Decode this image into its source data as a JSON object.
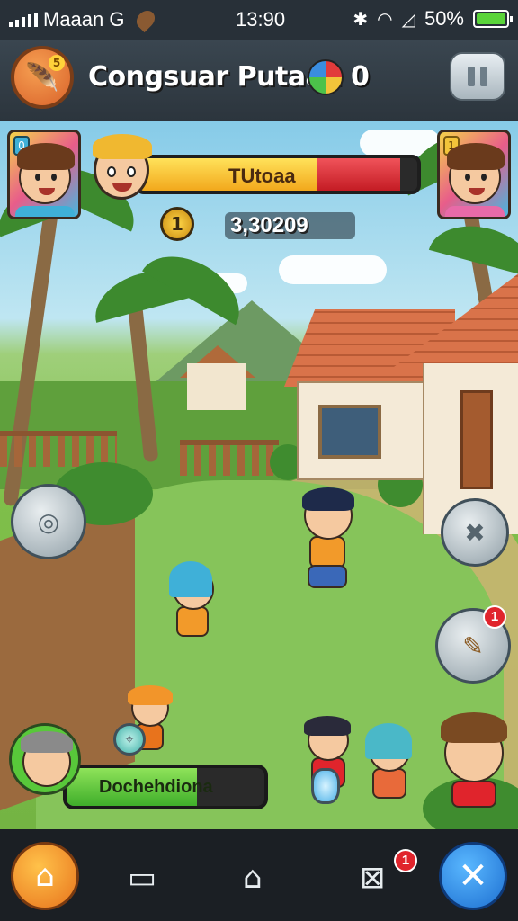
{
  "status_bar": {
    "carrier": "Maaan G",
    "time": "13:90",
    "battery": "50%"
  },
  "header": {
    "title": "Congsuar Putaan",
    "gem_count": "0",
    "avatar_coin": "5"
  },
  "hud": {
    "progress_label": "TUtoaa",
    "progress_fill": 0.64,
    "progress_loss": 0.3,
    "score": "3,30209",
    "coin_symbol": "1",
    "portrait_left_badge": "0",
    "portrait_right_badge": "1"
  },
  "actions": {
    "left_button_icon": "target-icon",
    "right_top_button_icon": "hammer-icon",
    "right_bottom_button_icon": "sword-icon",
    "right_bottom_badge": "1"
  },
  "player": {
    "name": "Dochehdiona",
    "bar_fill": 0.66
  },
  "nav": {
    "home_icon": "home-icon",
    "badge": "1",
    "close_icon": "close-icon"
  },
  "colors": {
    "accent_orange": "#e8731c",
    "accent_blue": "#1d6fd1",
    "alert_red": "#e0242c",
    "health_yellow": "#f2a81c",
    "health_green": "#3fae2a"
  }
}
